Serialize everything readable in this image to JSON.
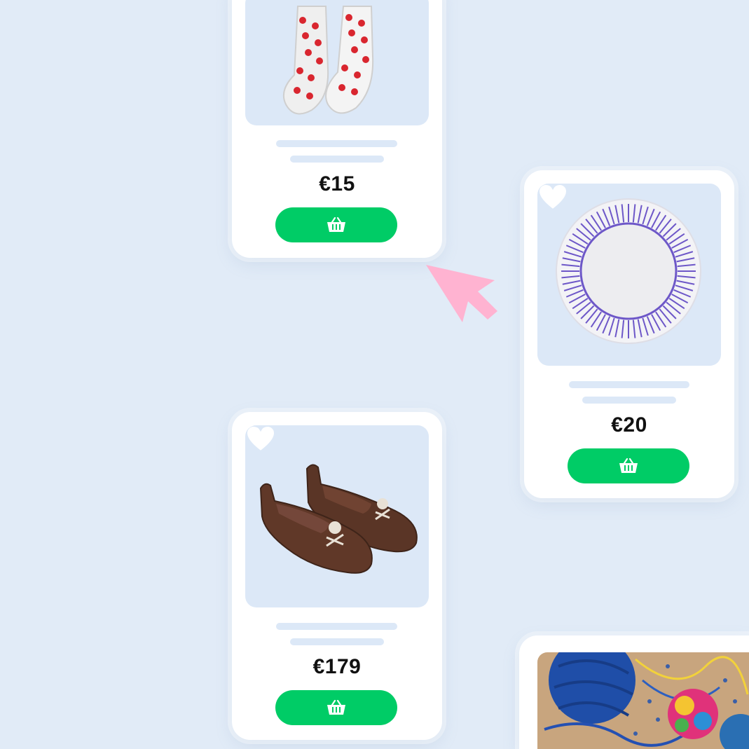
{
  "products": [
    {
      "name": "socks",
      "price": "€15",
      "favorite_icon": "heart-icon",
      "cart_icon": "basket-icon"
    },
    {
      "name": "plate",
      "price": "€20",
      "favorite_icon": "heart-icon",
      "cart_icon": "basket-icon"
    },
    {
      "name": "loafers",
      "price": "€179",
      "favorite_icon": "heart-icon",
      "cart_icon": "basket-icon"
    },
    {
      "name": "yarn"
    }
  ],
  "colors": {
    "background": "#e1ebf7",
    "placeholder": "#dce8f7",
    "button": "#00cc66",
    "cursor": "#ffb3d1"
  }
}
